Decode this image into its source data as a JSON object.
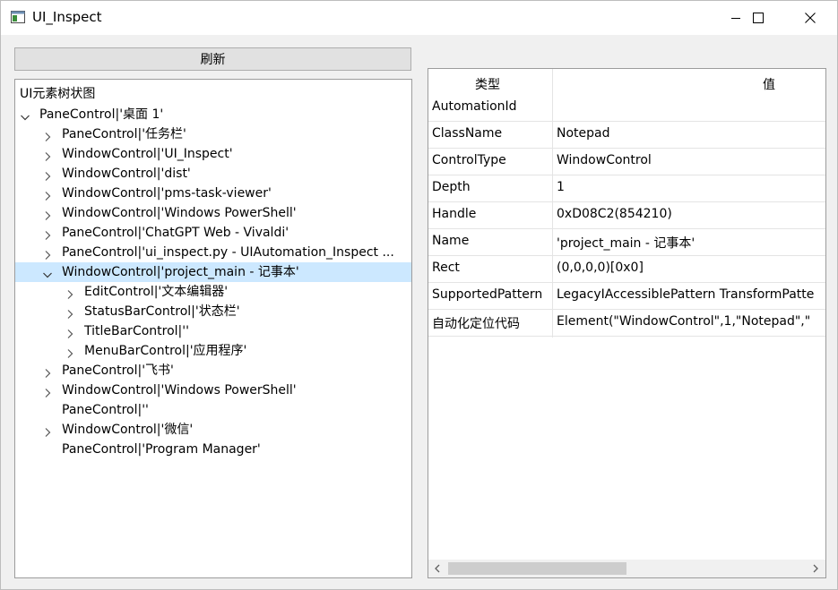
{
  "window": {
    "title": "UI_Inspect",
    "icon": "app-window-icon",
    "controls": [
      "minimize-icon",
      "maximize-icon",
      "close-icon"
    ]
  },
  "toolbar": {
    "refresh_label": "刷新"
  },
  "tree": {
    "header": "UI元素树状图",
    "items": [
      {
        "label": "PaneControl|'桌面 1'",
        "level": 0,
        "chevron": "down",
        "selected": false
      },
      {
        "label": "PaneControl|'任务栏'",
        "level": 1,
        "chevron": "right",
        "selected": false
      },
      {
        "label": "WindowControl|'UI_Inspect'",
        "level": 1,
        "chevron": "right",
        "selected": false
      },
      {
        "label": "WindowControl|'dist'",
        "level": 1,
        "chevron": "right",
        "selected": false
      },
      {
        "label": "WindowControl|'pms-task-viewer'",
        "level": 1,
        "chevron": "right",
        "selected": false
      },
      {
        "label": "WindowControl|'Windows PowerShell'",
        "level": 1,
        "chevron": "right",
        "selected": false
      },
      {
        "label": "PaneControl|'ChatGPT Web - Vivaldi'",
        "level": 1,
        "chevron": "right",
        "selected": false
      },
      {
        "label": "PaneControl|'ui_inspect.py - UIAutomation_Inspect ...",
        "level": 1,
        "chevron": "right",
        "selected": false
      },
      {
        "label": "WindowControl|'project_main - 记事本'",
        "level": 1,
        "chevron": "down",
        "selected": true
      },
      {
        "label": "EditControl|'文本编辑器'",
        "level": 2,
        "chevron": "right",
        "selected": false
      },
      {
        "label": "StatusBarControl|'状态栏'",
        "level": 2,
        "chevron": "right",
        "selected": false
      },
      {
        "label": "TitleBarControl|''",
        "level": 2,
        "chevron": "right",
        "selected": false
      },
      {
        "label": "MenuBarControl|'应用程序'",
        "level": 2,
        "chevron": "right",
        "selected": false
      },
      {
        "label": "PaneControl|'飞书'",
        "level": 1,
        "chevron": "right",
        "selected": false
      },
      {
        "label": "WindowControl|'Windows PowerShell'",
        "level": 1,
        "chevron": "right",
        "selected": false
      },
      {
        "label": "PaneControl|''",
        "level": 1,
        "chevron": "none",
        "selected": false
      },
      {
        "label": "WindowControl|'微信'",
        "level": 1,
        "chevron": "right",
        "selected": false
      },
      {
        "label": "PaneControl|'Program Manager'",
        "level": 1,
        "chevron": "none",
        "selected": false
      }
    ]
  },
  "properties": {
    "header_type": "类型",
    "header_value": "值",
    "rows": [
      {
        "key": "AutomationId",
        "value": ""
      },
      {
        "key": "ClassName",
        "value": "Notepad"
      },
      {
        "key": "ControlType",
        "value": "WindowControl"
      },
      {
        "key": "Depth",
        "value": "1"
      },
      {
        "key": "Handle",
        "value": "0xD08C2(854210)"
      },
      {
        "key": "Name",
        "value": "'project_main - 记事本'"
      },
      {
        "key": "Rect",
        "value": "(0,0,0,0)[0x0]"
      },
      {
        "key": "SupportedPattern",
        "value": "LegacyIAccessiblePattern TransformPatte"
      },
      {
        "key": "自动化定位代码",
        "value": "Element(\"WindowControl\",1,\"Notepad\",\""
      }
    ]
  },
  "colors": {
    "selection": "#cce8ff",
    "titlebar": "#ffffff",
    "button_face": "#e1e1e1"
  }
}
